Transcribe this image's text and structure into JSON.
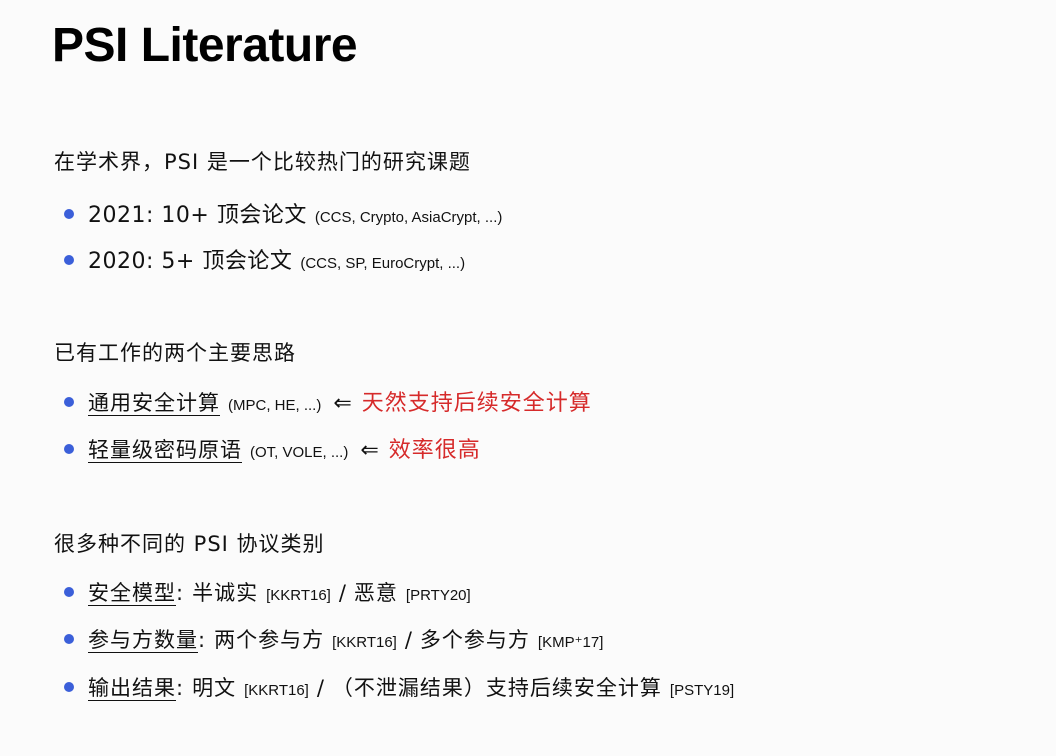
{
  "title": "PSI Literature",
  "section1": {
    "heading": "在学术界，PSI 是一个比较热门的研究课题",
    "items": [
      {
        "main": "2021: 10+ 顶会论文",
        "note": "(CCS, Crypto, AsiaCrypt, ...)"
      },
      {
        "main": "2020: 5+ 顶会论文",
        "note": "(CCS, SP, EuroCrypt, ...)"
      }
    ]
  },
  "section2": {
    "heading": "已有工作的两个主要思路",
    "items": [
      {
        "term": "通用安全计算",
        "note": "(MPC, HE, ...)",
        "arrow": "⇐",
        "comment": "天然支持后续安全计算"
      },
      {
        "term": "轻量级密码原语",
        "note": "(OT, VOLE, ...)",
        "arrow": "⇐",
        "comment": "效率很高"
      }
    ]
  },
  "section3": {
    "heading": "很多种不同的 PSI 协议类别",
    "items": [
      {
        "term": "安全模型",
        "colon": ":",
        "a": "半诚实",
        "a_ref": "[KKRT16]",
        "sep": "/",
        "b": "恶意",
        "b_ref": "[PRTY20]"
      },
      {
        "term": "参与方数量",
        "colon": ":",
        "a": "两个参与方",
        "a_ref": "[KKRT16]",
        "sep": "/",
        "b": "多个参与方",
        "b_ref": "[KMP⁺17]"
      },
      {
        "term": "输出结果",
        "colon": ":",
        "a": "明文",
        "a_ref": "[KKRT16]",
        "sep": "/",
        "b": "（不泄漏结果）支持后续安全计算",
        "b_ref": "[PSTY19]"
      }
    ]
  },
  "colors": {
    "bullet": "#3b5fd9",
    "highlight": "#d62a2a"
  }
}
